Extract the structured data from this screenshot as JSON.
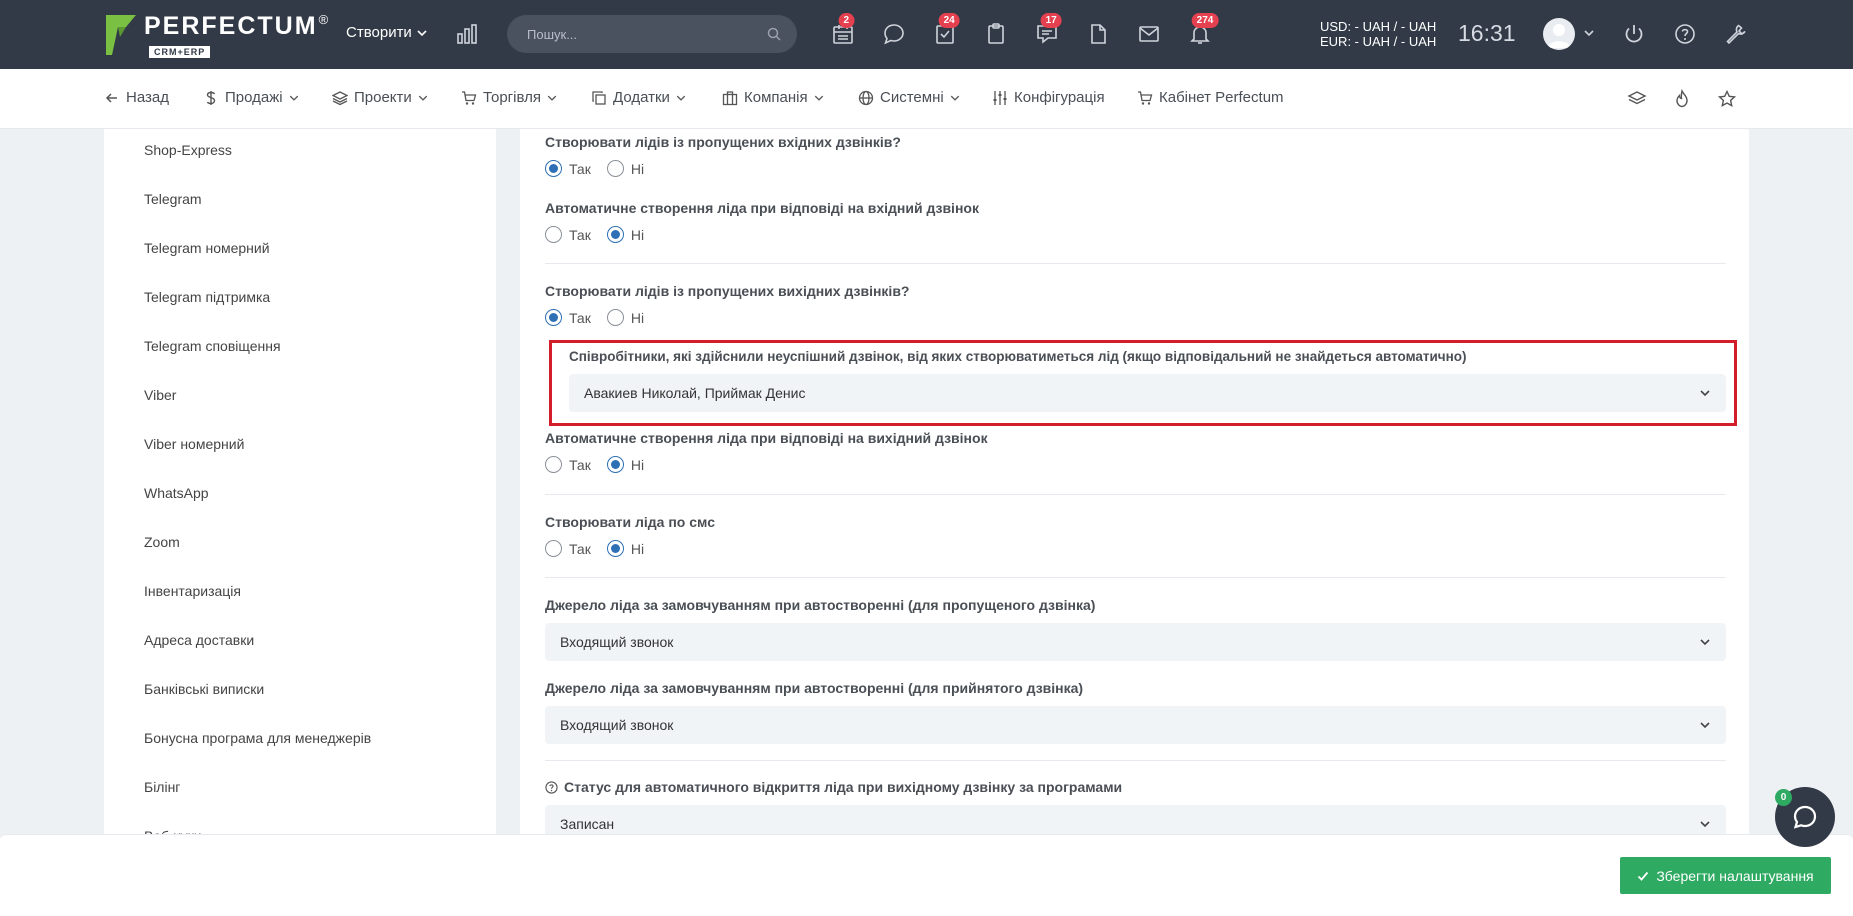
{
  "header": {
    "logo_text": "PERFECTUM",
    "logo_reg": "®",
    "logo_sub": "CRM+ERP",
    "create_label": "Створити",
    "search_placeholder": "Пошук...",
    "badges": {
      "calendar": "2",
      "tasks": "24",
      "comments": "17",
      "notifications": "274"
    },
    "usd": "USD: - UAH / - UAH",
    "eur": "EUR: - UAH / - UAH",
    "time": "16:31"
  },
  "nav": {
    "back": "Назад",
    "sales": "Продажі",
    "projects": "Проекти",
    "trade": "Торгівля",
    "addons": "Додатки",
    "company": "Компанія",
    "system": "Системні",
    "configuration": "Конфігурація",
    "cabinet": "Кабінет Perfectum"
  },
  "sidebar": {
    "items": [
      "Shop-Express",
      "Telegram",
      "Telegram номерний",
      "Telegram підтримка",
      "Telegram сповіщення",
      "Viber",
      "Viber номерний",
      "WhatsApp",
      "Zoom",
      "Інвентаризація",
      "Адреса доставки",
      "Банківські виписки",
      "Бонусна програма для менеджерів",
      "Білінг",
      "Веб-хуки"
    ]
  },
  "settings": {
    "yes": "Так",
    "no": "Ні",
    "missed_incoming_label": "Створювати лідів із пропущених вхідних дзвінків?",
    "auto_incoming_label": "Автоматичне створення ліда при відповіді на вхідний дзвінок",
    "missed_outgoing_label": "Створювати лідів із пропущених вихідних дзвінків?",
    "employees_label": "Співробітники, які здійснили неуспішний дзвінок, від яких створюватиметься лід (якщо відповідальний не знайдеться автоматично)",
    "employees_value": "Авакиев Николай, Приймак Денис",
    "auto_outgoing_label": "Автоматичне створення ліда при відповіді на вихідний дзвінок",
    "sms_label": "Створювати ліда по смс",
    "source_missed_label": "Джерело ліда за замовчуванням при автостворенні (для пропущеного дзвінка)",
    "source_missed_value": "Входящий звонок",
    "source_accepted_label": "Джерело ліда за замовчуванням при автостворенні (для прийнятого дзвінка)",
    "source_accepted_value": "Входящий звонок",
    "status_label": "Статус для автоматичного відкриття ліда при вихідному дзвінку за програмами",
    "status_value": "Записан"
  },
  "footer": {
    "save_label": "Зберегти налаштування",
    "chat_badge": "0"
  },
  "colors": {
    "header_bg": "#323a47",
    "accent_blue": "#2e6fb5",
    "badge_red": "#e5404f",
    "save_green": "#2eaa62",
    "highlight_red": "#d21e2b"
  }
}
